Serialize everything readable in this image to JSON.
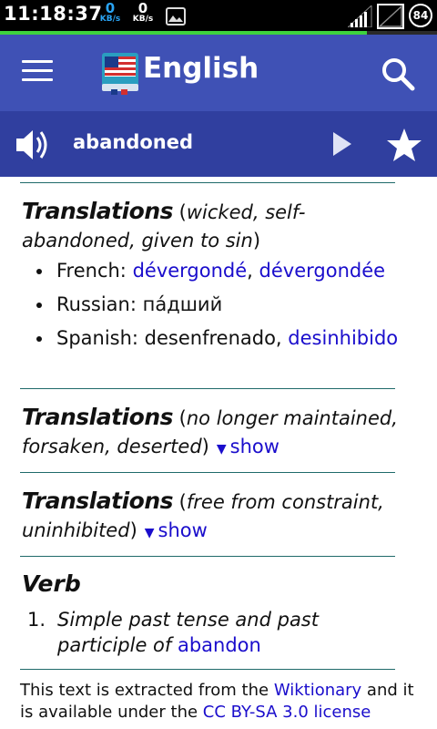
{
  "status_bar": {
    "time": "11:18:37",
    "download_speed": "0",
    "download_unit": "KB/s",
    "upload_speed": "0",
    "upload_unit": "KB/s",
    "battery": "84",
    "load_progress": 0.84
  },
  "app_bar": {
    "title": "English",
    "menu_icon": "hamburger-menu-icon",
    "search_icon": "search-icon",
    "logo_icon": "dictionary-flag-icon"
  },
  "word_bar": {
    "word": "abandoned",
    "speaker_icon": "speaker-icon",
    "play_icon": "play-icon",
    "star_icon": "star-icon"
  },
  "sections": {
    "s1": {
      "heading": "Translations",
      "gloss_open": " (",
      "gloss": "wicked, self-abandoned, given to sin",
      "gloss_close": ")",
      "items": [
        {
          "lang": "French: ",
          "t1": "dévergondé",
          "sep": ", ",
          "t2": "dévergondée"
        },
        {
          "lang": "Russian: пáдший"
        },
        {
          "lang": "Spanish: desenfrenado, ",
          "t1": "desinhibido"
        }
      ]
    },
    "s2": {
      "heading": "Translations",
      "gloss_open": " (",
      "gloss": "no longer maintained, forsaken, deserted",
      "gloss_close": ")",
      "show_arrow": "▼",
      "show_label": "show"
    },
    "s3": {
      "heading": "Translations",
      "gloss_open": " (",
      "gloss": "free from constraint, uninhibited",
      "gloss_close": ")",
      "show_arrow": "▼",
      "show_label": "show"
    },
    "verb": {
      "heading": "Verb",
      "number": "1.",
      "definition": "Simple past tense and past participle of ",
      "link": "abandon"
    }
  },
  "footer": {
    "text1": "This text is extracted from the ",
    "link1": "Wiktionary",
    "text2": " and it is available under the ",
    "link2": "CC BY-SA 3.0 license"
  },
  "colors": {
    "app_bar": "#3f51b5",
    "word_bar": "#303f9f",
    "link": "#1a0dcc",
    "divider": "#1f6a6a",
    "progress": "#3ed23e"
  }
}
